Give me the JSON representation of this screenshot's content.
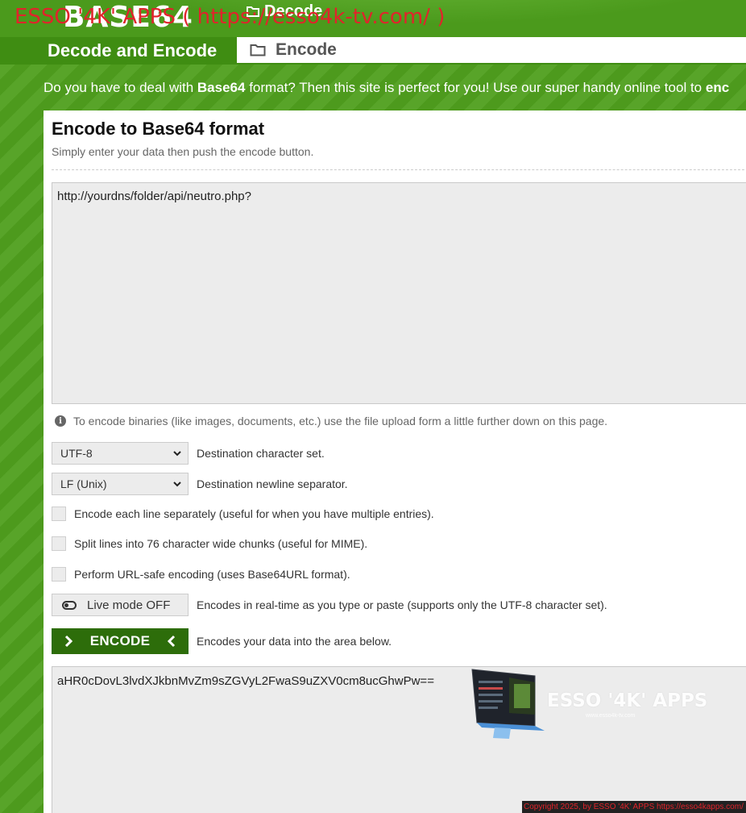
{
  "watermark": "ESSO '4K' APPS ( https://esso4k-tv.com/ )",
  "logo": "BASE64",
  "top_tab": "Decode",
  "nav": {
    "title": "Decode and Encode",
    "active_tab": "Encode"
  },
  "intro": {
    "part1": "Do you have to deal with ",
    "bold": "Base64",
    "part2": " format? Then this site is perfect for you! Use our super handy online tool to ",
    "bold2": "enc"
  },
  "panel": {
    "title": "Encode to Base64 format",
    "subtitle": "Simply enter your data then push the encode button.",
    "input_value": "http://yourdns/folder/api/neutro.php?",
    "hint": "To encode binaries (like images, documents, etc.) use the file upload form a little further down on this page.",
    "charset": {
      "value": "UTF-8",
      "label": "Destination character set."
    },
    "newline": {
      "value": "LF (Unix)",
      "label": "Destination newline separator."
    },
    "options": [
      "Encode each line separately (useful for when you have multiple entries).",
      "Split lines into 76 character wide chunks (useful for MIME).",
      "Perform URL-safe encoding (uses Base64URL format)."
    ],
    "live_mode": {
      "label": "Live mode OFF",
      "desc": "Encodes in real-time as you type or paste (supports only the UTF-8 character set)."
    },
    "encode": {
      "label": "ENCODE",
      "desc": "Encodes your data into the area below."
    },
    "output_value": "aHR0cDovL3lvdXJkbnMvZm9sZGVyL2FwaS9uZXV0cm8ucGhwPw=="
  },
  "promo": {
    "title": "ESSO '4K' APPS",
    "url": "www.esso4k-tv.com"
  },
  "footer": "Copyright 2025, by ESSO '4K' APPS https://esso4kapps.com/",
  "colors": {
    "green_bg": "#4f9f1e",
    "encode_button": "#2d6d0a",
    "watermark_red": "#e0242b"
  }
}
